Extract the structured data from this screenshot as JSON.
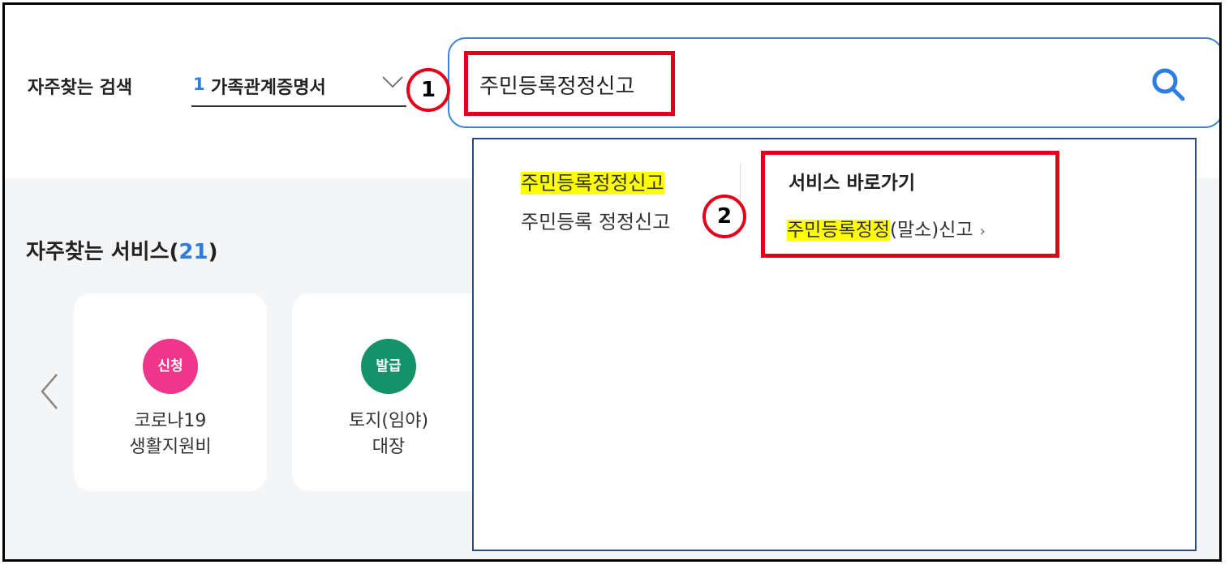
{
  "header": {
    "frequent_search_label": "자주찾는 검색",
    "frequent_rank": "1",
    "frequent_term": "가족관계증명서",
    "search_value": "주민등록정정신고"
  },
  "annotations": {
    "badge1": "1",
    "badge2": "2",
    "color": "#e3001b"
  },
  "autocomplete": {
    "suggestions": [
      {
        "highlight": "주민등록정정신고",
        "rest": ""
      },
      {
        "highlight": "",
        "rest": "주민등록 정정신고"
      }
    ],
    "shortcut_heading": "서비스 바로가기",
    "shortcut_link_highlight": "주민등록정정",
    "shortcut_link_rest": "(말소)신고",
    "shortcut_arrow": "›"
  },
  "services": {
    "title": "자주찾는 서비스(",
    "count": "21",
    "title_end": ")",
    "cards": [
      {
        "badge": "신청",
        "badge_color": "#f0368a",
        "line1": "코로나19",
        "line2": "생활지원비"
      },
      {
        "badge": "발급",
        "badge_color": "#14936a",
        "line1": "토지(임야)",
        "line2": "대장"
      }
    ],
    "edge_char": "주"
  },
  "colors": {
    "accent": "#2e7de0",
    "search_border": "#3b82d9",
    "dropdown_border": "#2b4a8b",
    "highlight": "#ffff00"
  }
}
